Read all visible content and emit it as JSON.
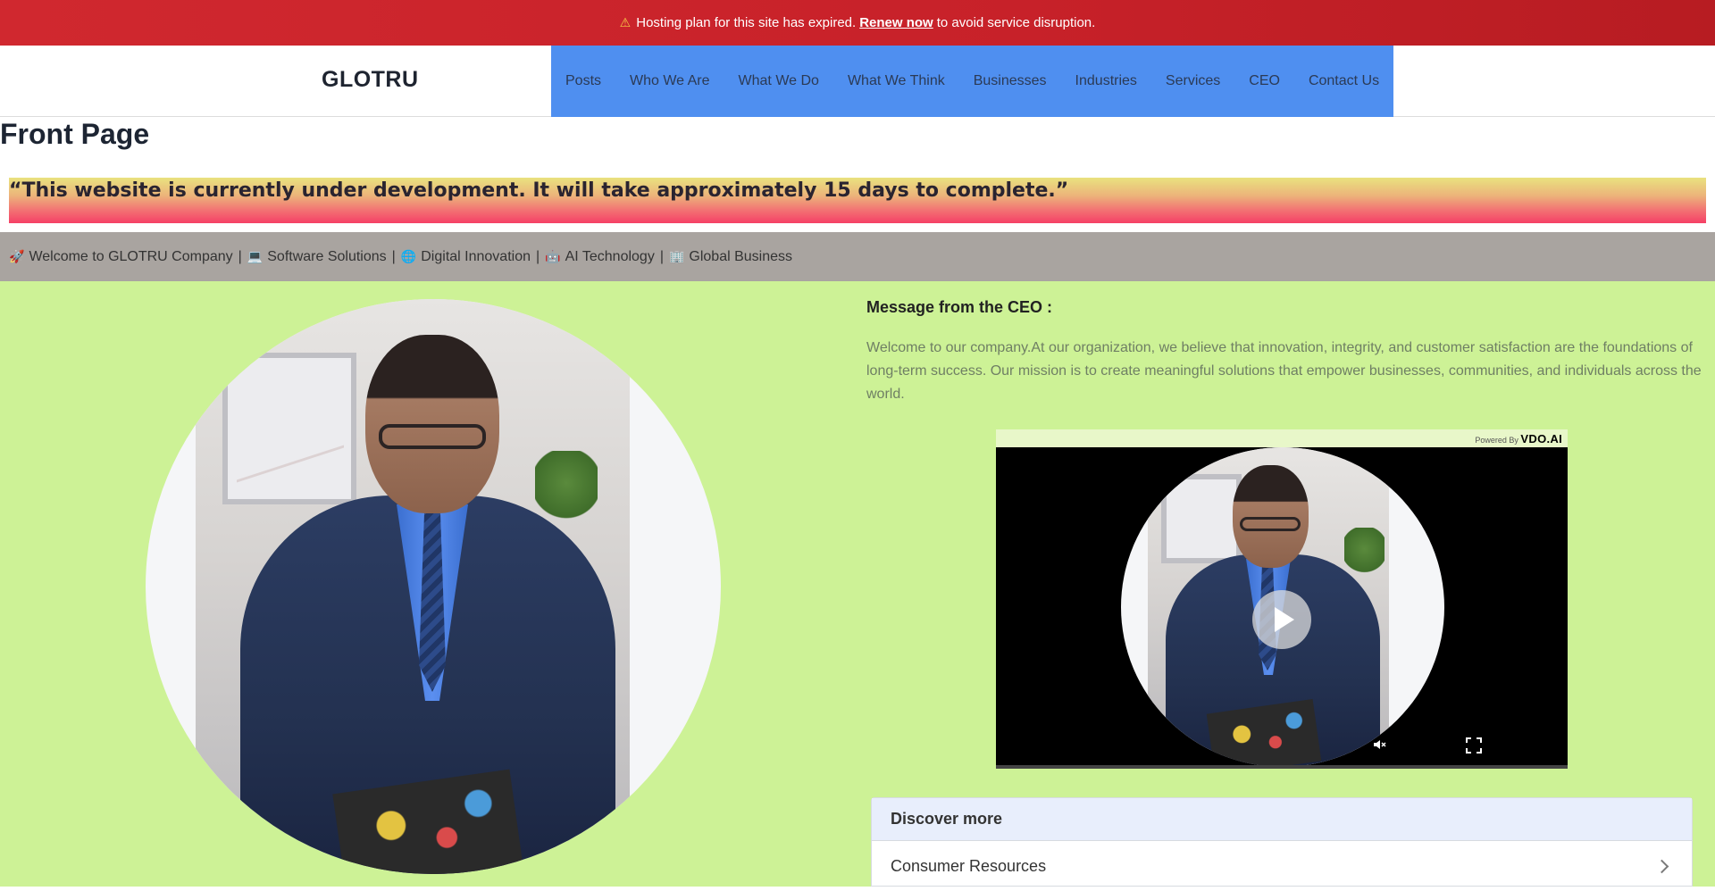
{
  "alert": {
    "icon": "warning-icon",
    "text_before": "Hosting plan for this site has expired.",
    "link": "Renew now",
    "text_after": "to avoid service disruption."
  },
  "header": {
    "logo": "GLOTRU",
    "nav": [
      "Posts",
      "Who We Are",
      "What We Do",
      "What We Think",
      "Businesses",
      "Industries",
      "Services",
      "CEO",
      "Contact Us"
    ]
  },
  "page_title": "Front Page",
  "dev_banner": "“This website is currently under development. It will take approximately 15 days to complete.”",
  "ticker": {
    "items": [
      {
        "icon": "rocket-icon",
        "glyph": "🚀",
        "label": "Welcome to GLOTRU Company"
      },
      {
        "icon": "laptop-icon",
        "glyph": "💻",
        "label": "Software Solutions"
      },
      {
        "icon": "globe-icon",
        "glyph": "🌐",
        "label": "Digital Innovation"
      },
      {
        "icon": "robot-icon",
        "glyph": "🤖",
        "label": "AI Technology"
      },
      {
        "icon": "office-icon",
        "glyph": "🏢",
        "label": "Global Business"
      }
    ],
    "separator": "|"
  },
  "ceo": {
    "title": "Message from the CEO :",
    "message": "Welcome to our company.At our organization, we believe that innovation, integrity, and customer satisfaction are the foundations of long-term success. Our mission is to create meaningful solutions that empower businesses, communities, and individuals across the world."
  },
  "player": {
    "powered_by": "Powered By",
    "brand": "VDO.AI",
    "controls": [
      "play-icon",
      "mute-icon",
      "fullscreen-icon"
    ]
  },
  "discover": {
    "heading": "Discover more",
    "items": [
      "Consumer Resources"
    ]
  }
}
